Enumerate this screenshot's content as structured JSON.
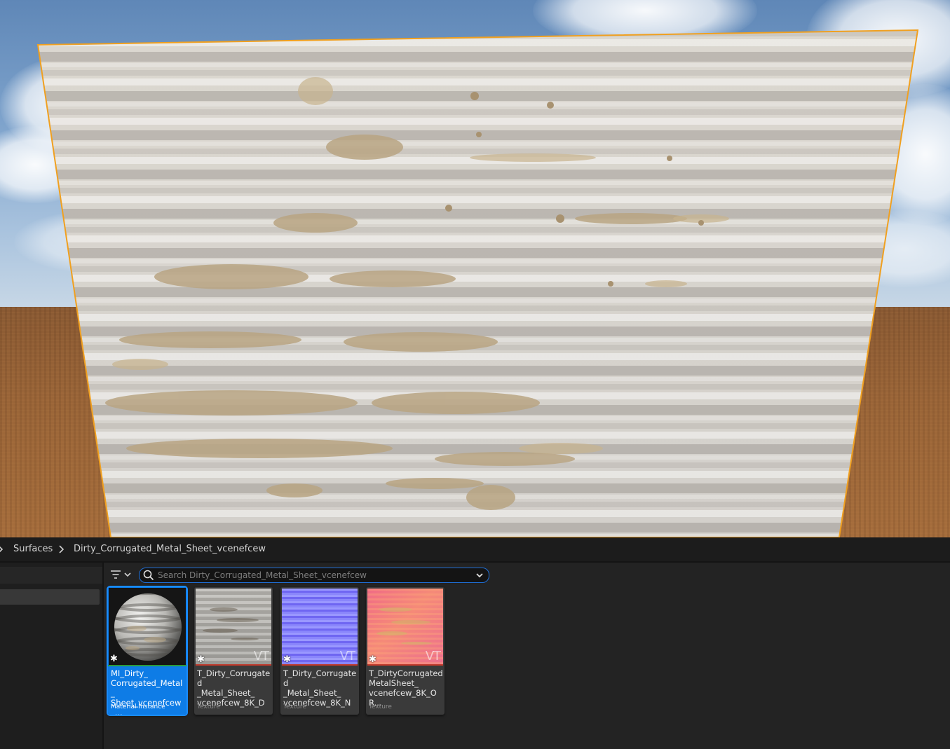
{
  "breadcrumb": {
    "items": [
      "Surfaces",
      "Dirty_Corrugated_Metal_Sheet_vcenefcew"
    ]
  },
  "search": {
    "placeholder": "Search Dirty_Corrugated_Metal_Sheet_vcenefcew",
    "value": ""
  },
  "assets": [
    {
      "name": "MI_Dirty_\nCorrugated_Metal_\nSheet_vcenefcew_...",
      "type": "Material Instance",
      "selected": true,
      "type_bar_color": "#2a9c3c"
    },
    {
      "name": "T_Dirty_Corrugated\n_Metal_Sheet_\nvcenefcew_8K_D",
      "type": "Texture",
      "badge": "VT",
      "selected": false,
      "type_bar_color": "#c0392b"
    },
    {
      "name": "T_Dirty_Corrugated\n_Metal_Sheet_\nvcenefcew_8K_N",
      "type": "Texture",
      "badge": "VT",
      "selected": false,
      "type_bar_color": "#c0392b"
    },
    {
      "name": "T_DirtyCorrugated\nMetalSheet_\nvcenefcew_8K_OR...",
      "type": "Texture",
      "badge": "VT",
      "selected": false,
      "type_bar_color": "#c0392b"
    }
  ],
  "colors": {
    "selection_accent": "#0e7ce6",
    "viewport_selection_outline": "#f0a020",
    "search_focus": "#1f6fd6"
  },
  "icons": {
    "breadcrumb_separator": "chevron-right-icon",
    "filter": "filter-icon",
    "search": "search-icon",
    "search_dropdown": "chevron-down-icon",
    "modified": "asterisk-icon"
  }
}
